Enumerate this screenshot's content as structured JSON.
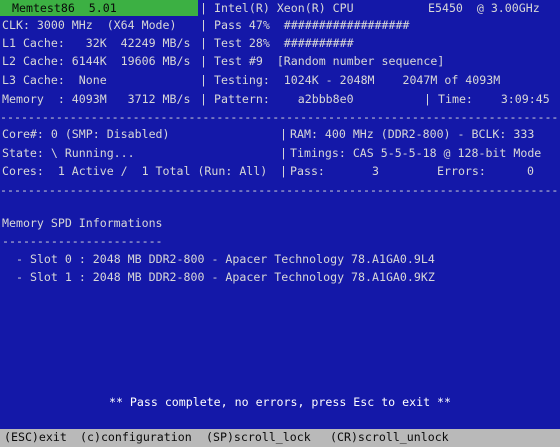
{
  "header": {
    "app_title": "Memtest86  5.01",
    "cpu_name": "Intel(R) Xeon(R) CPU",
    "cpu_model": "E5450  @ 3.00GHz",
    "clk": "CLK: 3000 MHz  (X64 Mode)",
    "l1": "L1 Cache:   32K  42249 MB/s",
    "l2": "L2 Cache: 6144K  19606 MB/s",
    "l3": "L3 Cache:  None",
    "memory": "Memory  : 4093M   3712 MB/s",
    "pass_progress": "Pass 47%  ##################",
    "test_progress": "Test 28%  ##########",
    "test_name": "Test #9  [Random number sequence]",
    "testing": "Testing:  1024K - 2048M    2047M of 4093M",
    "pattern": "Pattern:    a2bbb8e0",
    "time": "Time:    3:09:45"
  },
  "status": {
    "core": "Core#: 0 (SMP: Disabled)",
    "state": "State: \\ Running...",
    "cores": "Cores:  1 Active /  1 Total (Run: All)",
    "ram": "RAM: 400 MHz (DDR2-800) - BCLK: 333",
    "timings": "Timings: CAS 5-5-5-18 @ 128-bit Mode",
    "pass_label": "Pass:",
    "pass_value": "3",
    "errors_label": "Errors:",
    "errors_value": "0"
  },
  "spd": {
    "heading": "Memory SPD Informations",
    "underline": "-----------------------",
    "slots": [
      "- Slot 0 : 2048 MB DDR2-800 - Apacer Technology 78.A1GA0.9L4",
      "- Slot 1 : 2048 MB DDR2-800 - Apacer Technology 78.A1GA0.9KZ"
    ]
  },
  "message": "** Pass complete, no errors, press Esc to exit **",
  "footer": {
    "esc": "(ESC)exit",
    "config": "(c)configuration",
    "scroll_lock": "(SP)scroll_lock",
    "scroll_unlock": "(CR)scroll_unlock"
  },
  "dashes": "----------------------------------------------------------------------------------------------",
  "separator": "|",
  "colors": {
    "background": "#1418a8",
    "title_bg": "#3cb043",
    "footer_bg": "#b9b9b9",
    "text": "#d8d8d8"
  }
}
